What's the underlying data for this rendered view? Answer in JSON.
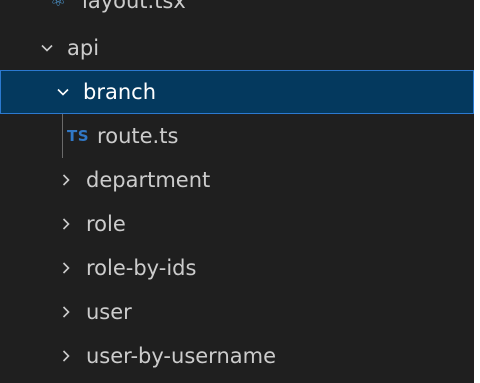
{
  "explorer": {
    "top_item_partial": "layout.tsx",
    "items": [
      {
        "label": "api",
        "type": "folder",
        "expanded": true
      },
      {
        "label": "branch",
        "type": "folder",
        "expanded": true,
        "selected": true
      },
      {
        "label": "route.ts",
        "type": "file",
        "icon_text": "TS"
      },
      {
        "label": "department",
        "type": "folder",
        "expanded": false
      },
      {
        "label": "role",
        "type": "folder",
        "expanded": false
      },
      {
        "label": "role-by-ids",
        "type": "folder",
        "expanded": false
      },
      {
        "label": "user",
        "type": "folder",
        "expanded": false
      },
      {
        "label": "user-by-username",
        "type": "folder",
        "expanded": false
      }
    ]
  },
  "colors": {
    "background": "#1f1f1f",
    "selected_background": "#04395e",
    "selected_border": "#2b79d0",
    "text": "#cccccc",
    "ts_icon": "#3178c6"
  },
  "icons": {
    "expanded": "chevron-down-icon",
    "collapsed": "chevron-right-icon",
    "file": "typescript-file-icon"
  }
}
